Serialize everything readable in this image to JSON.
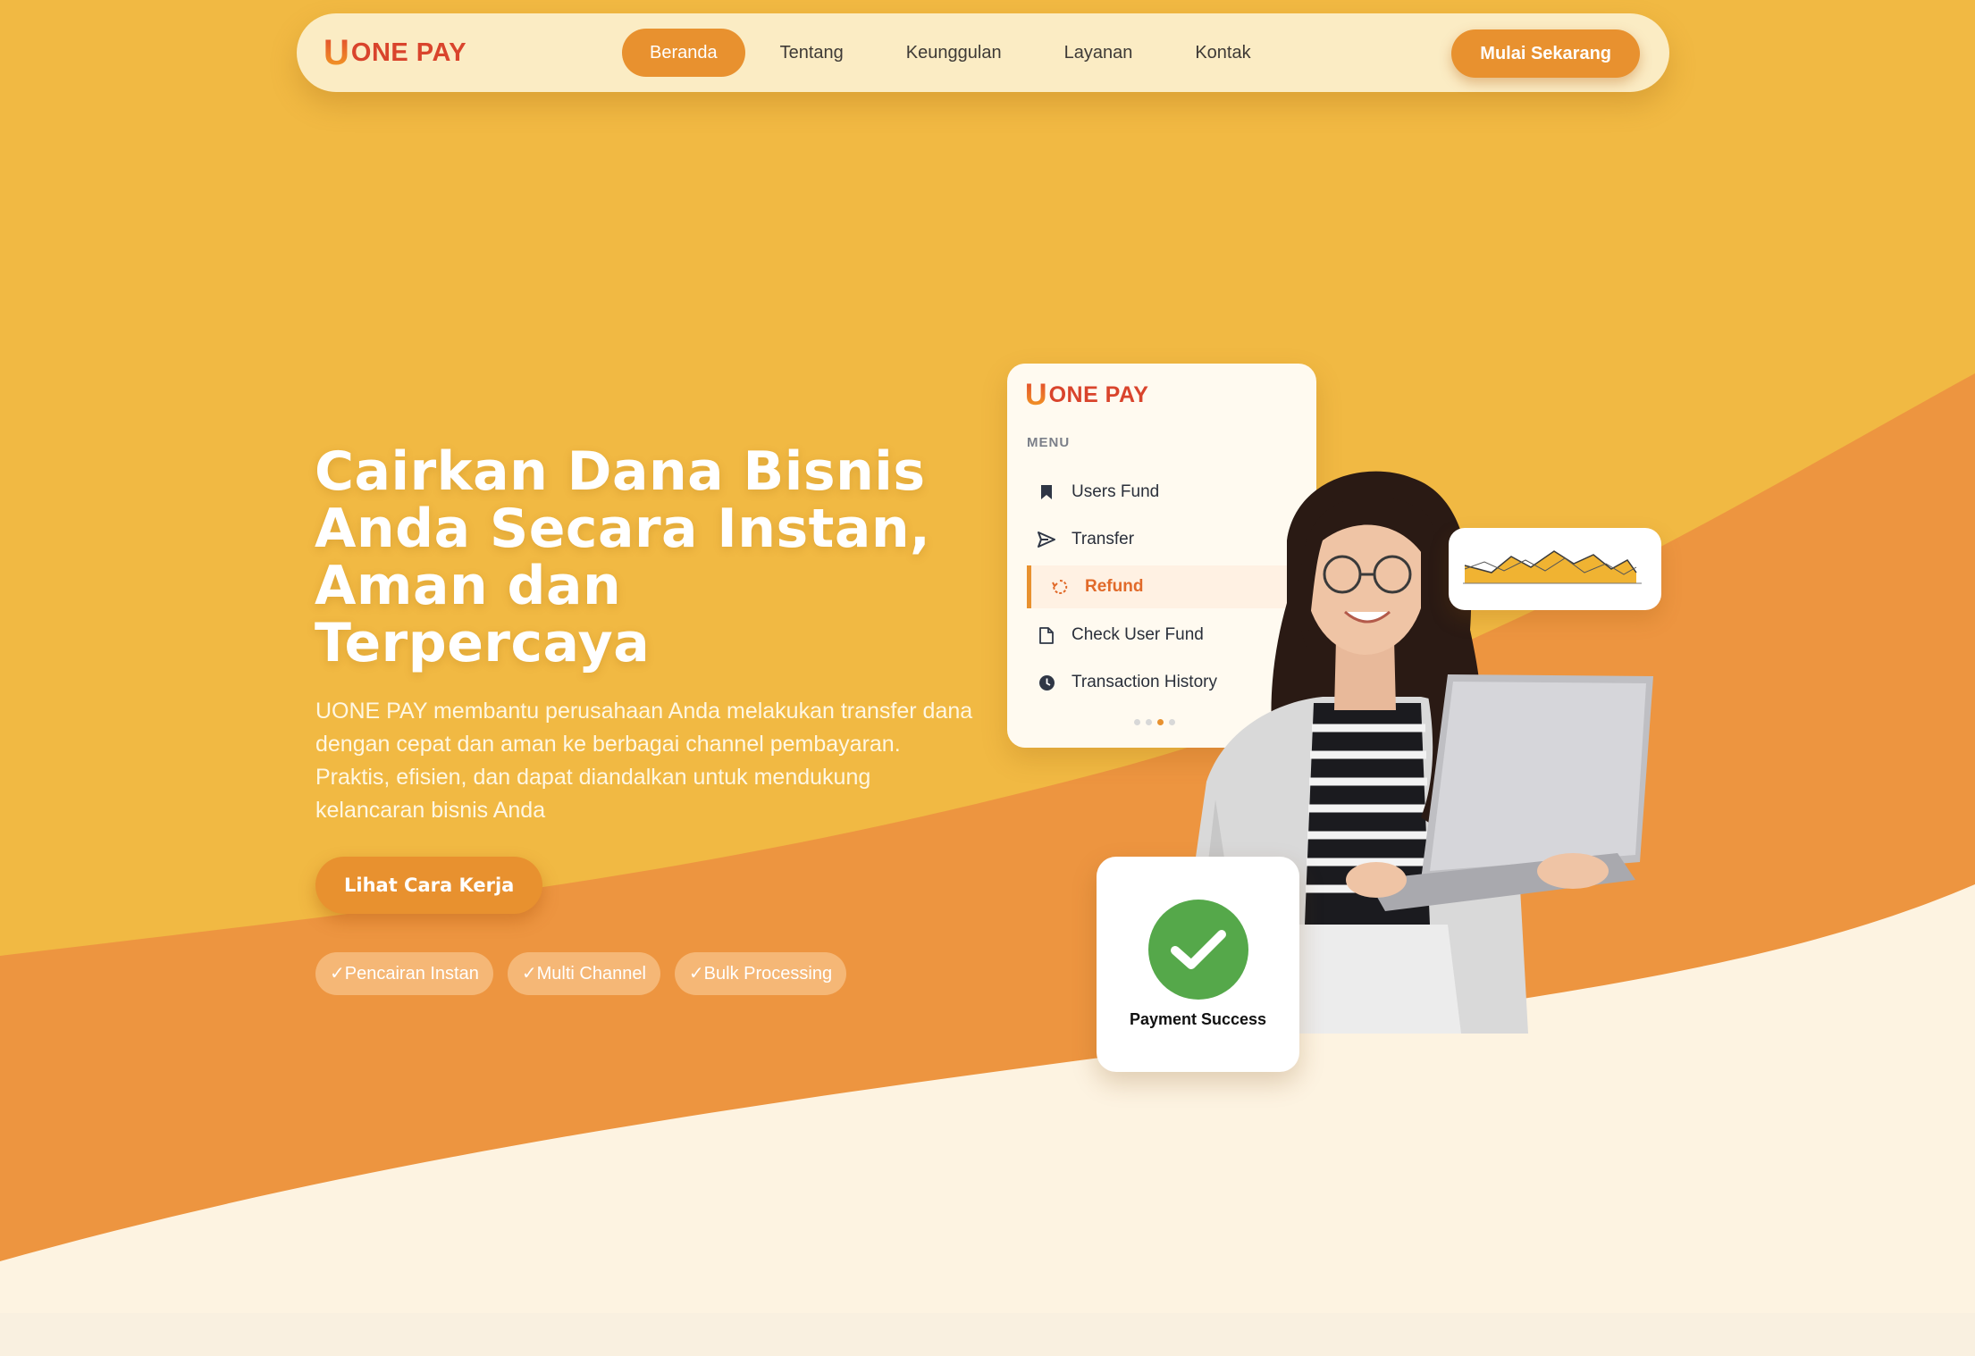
{
  "brand": {
    "logo_letter": "U",
    "logo_text": "ONE PAY"
  },
  "nav": {
    "items": [
      {
        "label": "Beranda",
        "active": true
      },
      {
        "label": "Tentang",
        "active": false
      },
      {
        "label": "Keunggulan",
        "active": false
      },
      {
        "label": "Layanan",
        "active": false
      },
      {
        "label": "Kontak",
        "active": false
      }
    ],
    "cta_label": "Mulai Sekarang"
  },
  "hero": {
    "title_lines": [
      "Cairkan Dana Bisnis",
      "Anda Secara Instan,",
      "Aman dan",
      "Terpercaya"
    ],
    "subtitle": "UONE PAY membantu perusahaan Anda melakukan transfer dana dengan cepat dan aman ke berbagai channel pembayaran. Praktis, efisien, dan dapat diandalkan untuk mendukung kelancaran bisnis Anda",
    "button_label": "Lihat Cara Kerja",
    "badges": [
      "✓Pencairan Instan",
      "✓Multi Channel",
      "✓Bulk Processing"
    ]
  },
  "app_card": {
    "menu_label": "MENU",
    "items": [
      {
        "label": "Users Fund",
        "icon": "bookmark-icon",
        "active": false
      },
      {
        "label": "Transfer",
        "icon": "send-icon",
        "active": false
      },
      {
        "label": "Refund",
        "icon": "refresh-icon",
        "active": true
      },
      {
        "label": "Check User Fund",
        "icon": "file-icon",
        "active": false
      },
      {
        "label": "Transaction History",
        "icon": "clock-icon",
        "active": false
      }
    ],
    "dots_active_index": 2
  },
  "success_card": {
    "label": "Payment Success",
    "icon": "check-icon"
  },
  "colors": {
    "background_top": "#f1b943",
    "wave_orange": "#ed9540",
    "cream": "#fdf3e1",
    "accent": "#e8912f",
    "logo_red": "#d9442c",
    "success_green": "#55a84a"
  }
}
